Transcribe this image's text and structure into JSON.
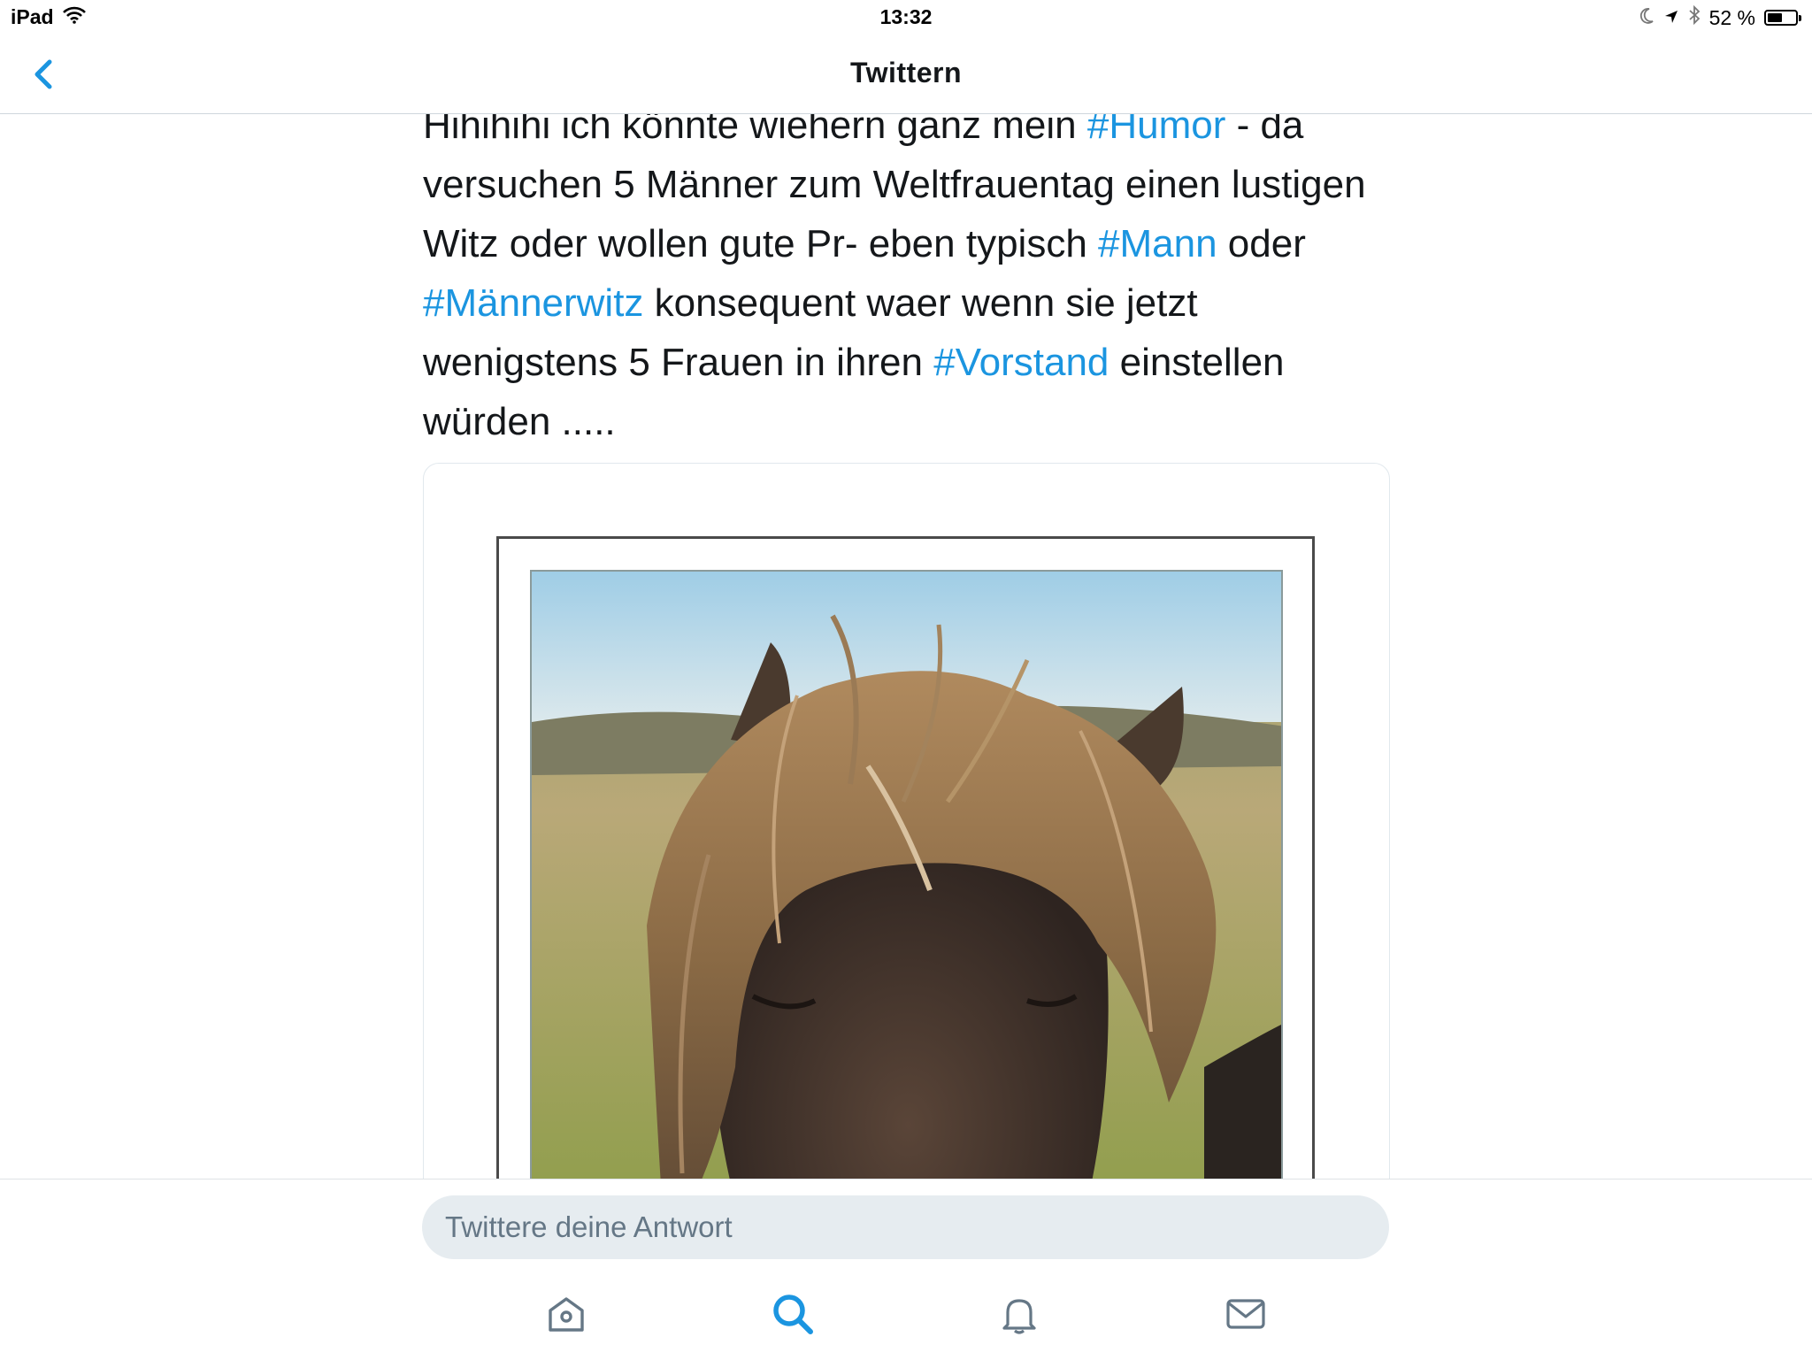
{
  "status_bar": {
    "device": "iPad",
    "time": "13:32",
    "battery_percent": "52 %",
    "battery_level": 0.52
  },
  "nav": {
    "title": "Twittern",
    "back_icon": "chevron-left-icon"
  },
  "tweet": {
    "segments": [
      {
        "text": "Hihihihi ich könnte wiehern ganz mein ",
        "hashtag": false
      },
      {
        "text": "#Humor",
        "hashtag": true
      },
      {
        "text": " - da versuchen 5 Männer zum Weltfrauentag einen lustigen Witz oder wollen gute Pr- eben typisch ",
        "hashtag": false
      },
      {
        "text": "#Mann",
        "hashtag": true
      },
      {
        "text": " oder ",
        "hashtag": false
      },
      {
        "text": "#Männerwitz",
        "hashtag": true
      },
      {
        "text": " konsequent waer wenn sie jetzt wenigstens 5 Frauen in ihren ",
        "hashtag": false
      },
      {
        "text": "#Vorstand",
        "hashtag": true
      },
      {
        "text": " einstellen würden .....",
        "hashtag": false
      }
    ],
    "media_description_icon": "photo-icon"
  },
  "reply": {
    "placeholder": "Twittere deine Antwort"
  },
  "tabbar": {
    "items": [
      {
        "name": "home",
        "icon": "home-icon",
        "active": false
      },
      {
        "name": "search",
        "icon": "search-icon",
        "active": true
      },
      {
        "name": "notifications",
        "icon": "bell-icon",
        "active": false
      },
      {
        "name": "messages",
        "icon": "mail-icon",
        "active": false
      }
    ]
  },
  "colors": {
    "accent": "#1b95e0",
    "text": "#14171a",
    "secondary_text": "#657786",
    "reply_bg": "#e6ecf0"
  }
}
